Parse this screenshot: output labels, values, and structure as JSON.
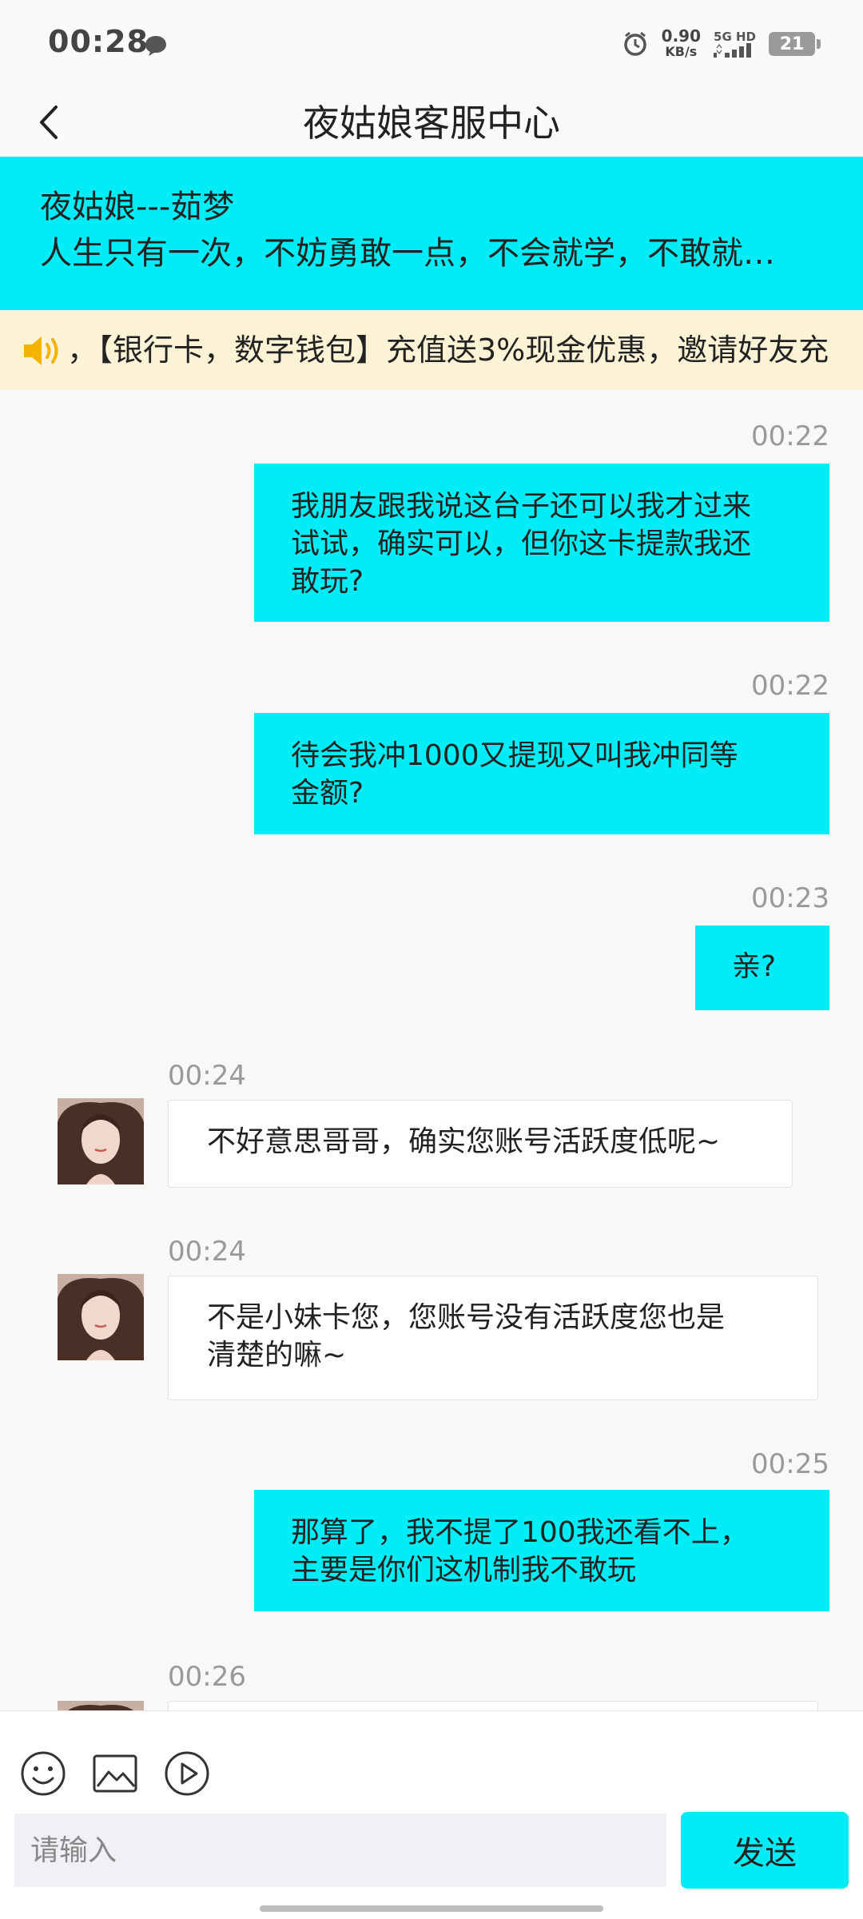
{
  "status_bar": {
    "time": "00:28",
    "net_speed_value": "0.90",
    "net_speed_unit": "KB/s",
    "net_type_top": "5G HD",
    "battery": "21"
  },
  "nav": {
    "title": "夜姑娘客服中心"
  },
  "notice": {
    "title": "夜姑娘---茹梦",
    "text": "人生只有一次，不妨勇敢一点，不会就学，不敢就…"
  },
  "marquee": {
    "text": "，【银行卡，数字钱包】充值送3%现金优惠，邀请好友充"
  },
  "messages": [
    {
      "side": "out",
      "time": "00:22",
      "lines": [
        "我朋友跟我说这台子还可以我才过来",
        "试试，确实可以，但你这卡提款我还",
        "敢玩?"
      ]
    },
    {
      "side": "out",
      "time": "00:22",
      "lines": [
        "待会我冲1000又提现又叫我冲同等",
        "金额?"
      ]
    },
    {
      "side": "out",
      "time": "00:23",
      "lines": [
        "亲?"
      ]
    },
    {
      "side": "in",
      "time": "00:24",
      "lines": [
        "不好意思哥哥，确实您账号活跃度低呢~"
      ]
    },
    {
      "side": "in",
      "time": "00:24",
      "lines": [
        "不是小妹卡您，您账号没有活跃度您也是",
        "清楚的嘛~"
      ]
    },
    {
      "side": "out",
      "time": "00:25",
      "lines": [
        "那算了，我不提了100我还看不上，",
        "主要是你们这机制我不敢玩"
      ]
    },
    {
      "side": "in",
      "time": "00:26",
      "lines": [
        ""
      ]
    }
  ],
  "input": {
    "placeholder": "请输入",
    "send_label": "发送"
  },
  "colors": {
    "accent": "#00ecf6",
    "marquee_bg": "#fcf3d6",
    "speaker": "#f5b300"
  },
  "icons": [
    "chat-bubble-icon",
    "alarm-icon",
    "signal-icon",
    "back-icon",
    "speaker-icon",
    "emoji-icon",
    "image-icon",
    "video-icon"
  ]
}
